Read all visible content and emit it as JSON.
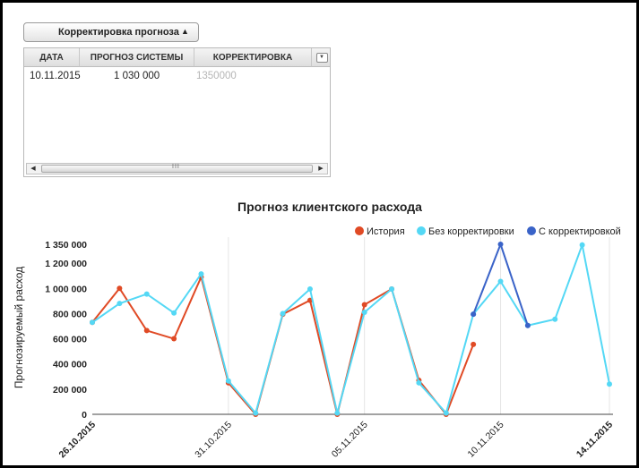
{
  "forecast_panel": {
    "toggle_label": "Корректировка прогноза",
    "toggle_icon": "caret-up-icon",
    "columns": [
      "ДАТА",
      "ПРОГНОЗ СИСТЕМЫ",
      "КОРРЕКТИРОВКА"
    ],
    "rows": [
      {
        "date": "10.11.2015",
        "system": "1 030 000",
        "adjustment": "1350000"
      }
    ],
    "scroll_grip": "III"
  },
  "chart_data": {
    "type": "line",
    "title": "Прогноз клиентского расхода",
    "ylabel": "Прогнозируемый расход",
    "ylim": [
      0,
      1350000
    ],
    "y_ticks": [
      "0",
      "200 000",
      "400 000",
      "600 000",
      "800 000",
      "1 000 000",
      "1 200 000",
      "1 350 000"
    ],
    "x": [
      "26.10.2015",
      "27.10.2015",
      "28.10.2015",
      "29.10.2015",
      "30.10.2015",
      "31.10.2015",
      "01.11.2015",
      "02.11.2015",
      "03.11.2015",
      "04.11.2015",
      "05.11.2015",
      "06.11.2015",
      "07.11.2015",
      "08.11.2015",
      "09.11.2015",
      "10.11.2015",
      "11.11.2015",
      "12.11.2015",
      "13.11.2015",
      "14.11.2015"
    ],
    "x_ticks": [
      "26.10.2015",
      "31.10.2015",
      "05.11.2015",
      "10.11.2015",
      "14.11.2015"
    ],
    "series": [
      {
        "name": "История",
        "color": "#e04a25",
        "values": [
          730000,
          1000000,
          665000,
          600000,
          1090000,
          250000,
          0,
          795000,
          905000,
          0,
          870000,
          995000,
          270000,
          0,
          555000,
          null,
          null,
          null,
          null,
          null
        ]
      },
      {
        "name": "Без корректировки",
        "color": "#54d8f5",
        "values": [
          730000,
          880000,
          955000,
          805000,
          1115000,
          265000,
          10000,
          800000,
          995000,
          10000,
          810000,
          995000,
          250000,
          10000,
          795000,
          1055000,
          705000,
          755000,
          1345000,
          240000
        ]
      },
      {
        "name": "С корректировкой",
        "color": "#3a63c8",
        "values": [
          null,
          null,
          null,
          null,
          null,
          null,
          null,
          null,
          null,
          null,
          null,
          null,
          null,
          null,
          795000,
          1350000,
          705000,
          null,
          null,
          null
        ]
      }
    ],
    "legend_position": "top-right",
    "grid": "vertical"
  }
}
